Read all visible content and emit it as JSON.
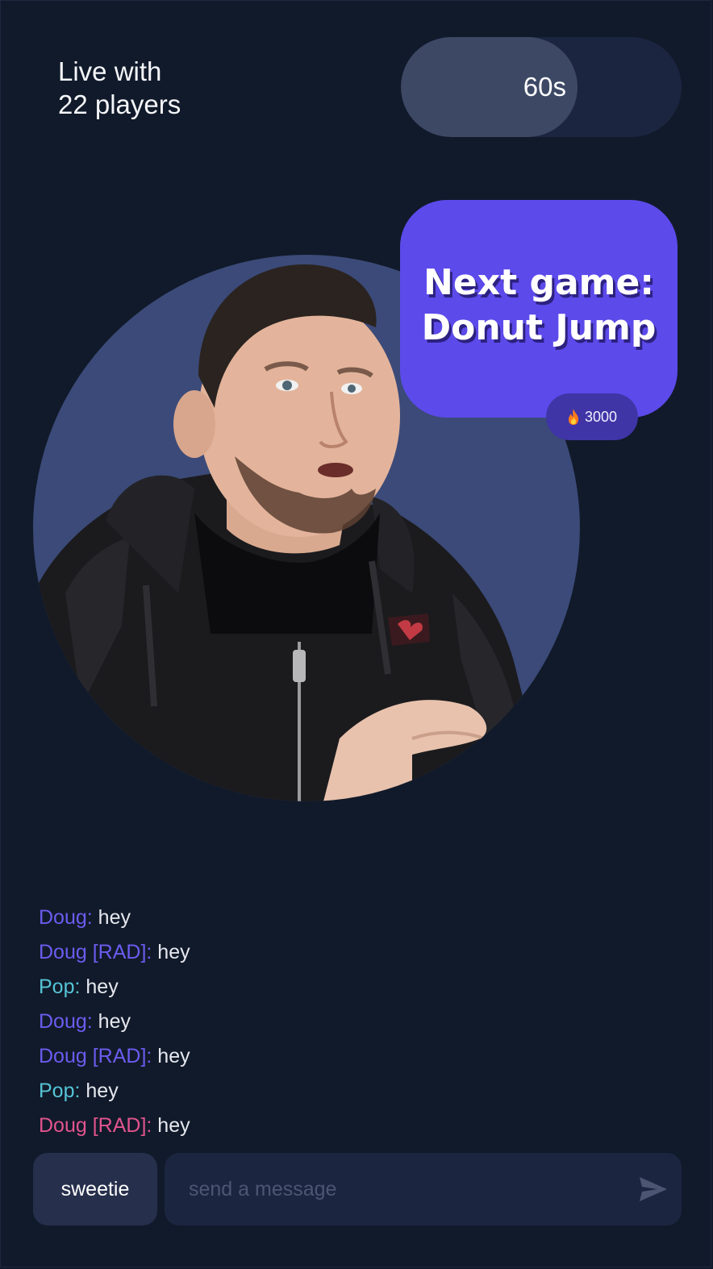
{
  "header": {
    "live_line1": "Live with",
    "live_line2": "22 players",
    "timer_label": "60s",
    "timer_progress": 0.63
  },
  "host": {
    "background_color": "#3b4a78"
  },
  "next_game": {
    "line1": "Next game:",
    "line2": "Donut Jump",
    "reward": "3000",
    "reward_icon": "fire-icon",
    "card_color": "#5c4aea"
  },
  "chat": {
    "messages": [
      {
        "author": "Doug:",
        "text": "hey",
        "color": "#6b5cf0"
      },
      {
        "author": "Doug [RAD]:",
        "text": "hey",
        "color": "#6b5cf0"
      },
      {
        "author": "Pop:",
        "text": "hey",
        "color": "#55c4d6"
      },
      {
        "author": "Doug:",
        "text": "hey",
        "color": "#6b5cf0"
      },
      {
        "author": "Doug [RAD]:",
        "text": "hey",
        "color": "#6b5cf0"
      },
      {
        "author": "Pop:",
        "text": "hey",
        "color": "#55c4d6"
      },
      {
        "author": "Doug [RAD]:",
        "text": "hey",
        "color": "#e2548e"
      }
    ]
  },
  "composer": {
    "name_label": "sweetie",
    "placeholder": "send a message",
    "value": "",
    "send_icon": "send-icon"
  }
}
